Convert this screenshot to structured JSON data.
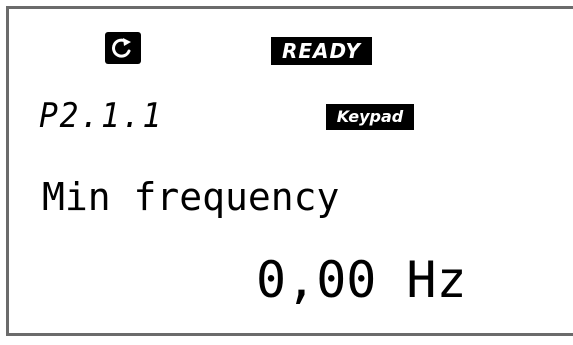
{
  "status_bar": {
    "run_icon": "rotation-arrow-icon",
    "state": "READY"
  },
  "parameter": {
    "code": "P2.1.1",
    "control_place": "Keypad",
    "name": "Min frequency",
    "value": "0,00",
    "unit": "Hz"
  },
  "colors": {
    "background": "#ffffff",
    "text": "#000000",
    "badge_bg": "#000000",
    "badge_text": "#ffffff",
    "frame": "#6b6b6b"
  }
}
